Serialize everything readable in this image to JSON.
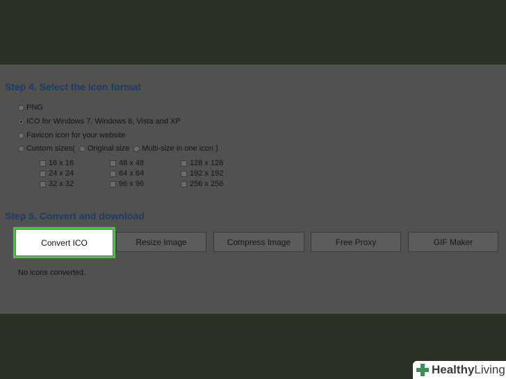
{
  "step4": {
    "title": "Step 4. Select the icon format",
    "options": [
      {
        "label": "PNG",
        "checked": false
      },
      {
        "label": "ICO for Windows 7, Windows 8, Vista and XP",
        "checked": true
      },
      {
        "label": "Favicon icon for your website",
        "checked": false
      }
    ],
    "custom": {
      "label": "Custom sizes(",
      "original_label": "Original size",
      "multi_label": "Multi-size in one icon )"
    },
    "sizes": [
      "16 x 16",
      "48 x 48",
      "128 x 128",
      "24 x 24",
      "64 x 64",
      "192 x 192",
      "32 x 32",
      "96 x 96",
      "256 x 256"
    ]
  },
  "step5": {
    "title": "Step 5. Convert and download",
    "buttons": [
      "Convert ICO",
      "Resize Image",
      "Compress Image",
      "Free Proxy",
      "GIF Maker"
    ],
    "status": "No icons converted."
  },
  "watermark": {
    "healthy": "Healthy",
    "living": "Living"
  },
  "colors": {
    "highlight": "#35d22b",
    "title": "#1b3b6b",
    "overlay": "#515150"
  }
}
